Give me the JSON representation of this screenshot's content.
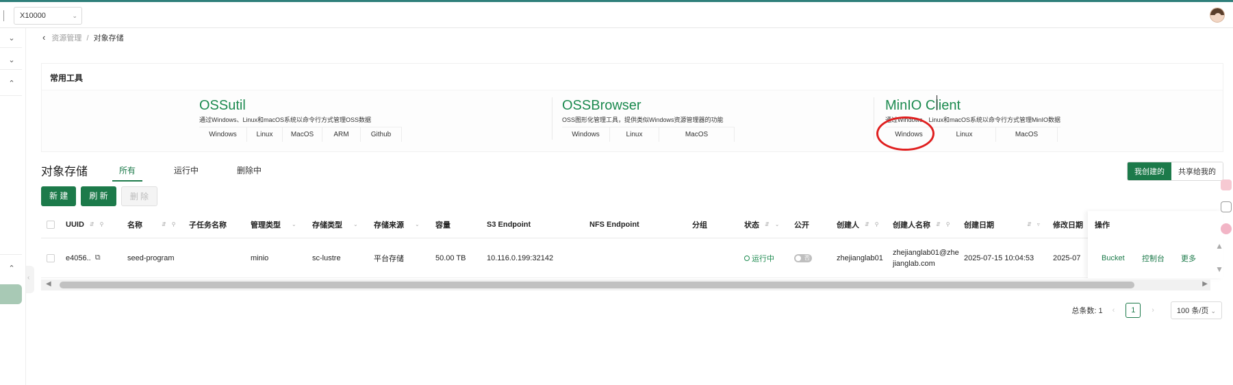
{
  "topbar": {
    "org_value": "X10000"
  },
  "breadcrumb": {
    "parent": "资源管理",
    "separator": "/",
    "current": "对象存储"
  },
  "tools": {
    "title": "常用工具",
    "items": [
      {
        "name": "OSSutil",
        "desc": "通过Windows、Linux和macOS系统以命令行方式管理OSS数据",
        "links": [
          "Windows",
          "Linux",
          "MacOS",
          "ARM",
          "Github"
        ]
      },
      {
        "name": "OSSBrowser",
        "desc": "OSS图形化管理工具，提供类似Windows资源管理器的功能",
        "links": [
          "Windows",
          "Linux",
          "MacOS"
        ]
      },
      {
        "name": "MinIO Client",
        "desc": "通过Windows、Linux和macOS系统以命令行方式管理MinIO数据",
        "links": [
          "Windows",
          "Linux",
          "MacOS"
        ]
      }
    ]
  },
  "section": {
    "title": "对象存储",
    "tabs": [
      "所有",
      "运行中",
      "删除中"
    ],
    "scope": [
      "我创建的",
      "共享给我的"
    ]
  },
  "actions": {
    "create": "新 建",
    "refresh": "刷 新",
    "delete": "删 除"
  },
  "table": {
    "headers": [
      "UUID",
      "名称",
      "子任务名称",
      "管理类型",
      "存储类型",
      "存储来源",
      "容量",
      "S3 Endpoint",
      "NFS Endpoint",
      "分组",
      "状态",
      "公开",
      "创建人",
      "创建人名称",
      "创建日期",
      "修改日期",
      "操作"
    ],
    "rows": [
      {
        "uuid": "e4056..",
        "name": "seed-program",
        "subtask": "",
        "mgmt_type": "minio",
        "storage_type": "sc-lustre",
        "source": "平台存储",
        "capacity": "50.00 TB",
        "s3": "10.116.0.199:32142",
        "nfs": "",
        "group": "",
        "status": "运行中",
        "public_label": "否",
        "creator": "zhejianglab01",
        "creator_name": "zhejianglab01@zhejianglab.com",
        "created": "2025-07-15 10:04:53",
        "modified": "2025-07",
        "ops": [
          "Bucket",
          "控制台",
          "更多"
        ]
      }
    ]
  },
  "pager": {
    "total_label": "总条数: 1",
    "page": "1",
    "size": "100 条/页"
  },
  "colors": {
    "brand": "#1c7a4a",
    "highlight": "#e01f1f"
  }
}
